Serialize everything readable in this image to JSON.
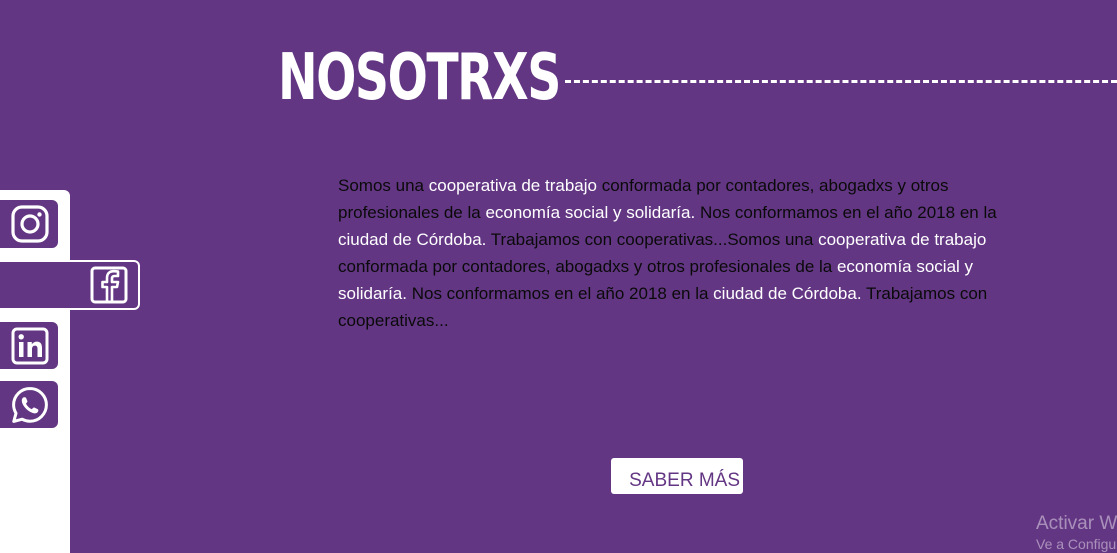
{
  "section": {
    "title": "NOSOTRXS"
  },
  "about": {
    "segments": [
      {
        "text": "Somos una ",
        "highlight": false
      },
      {
        "text": "cooperativa de trabajo",
        "highlight": true
      },
      {
        "text": " conformada por contadores, abogadxs y otros profesionales de la ",
        "highlight": false
      },
      {
        "text": "economía social y solidaría.",
        "highlight": true
      },
      {
        "text": " Nos conformamos en el año 2018 en la ",
        "highlight": false
      },
      {
        "text": "ciudad de Córdoba.",
        "highlight": true
      },
      {
        "text": " Trabajamos con cooperativas...Somos una ",
        "highlight": false
      },
      {
        "text": "cooperativa de trabajo",
        "highlight": true
      },
      {
        "text": " conformada por contadores, abogadxs y otros profesionales de la ",
        "highlight": false
      },
      {
        "text": "economía social y solidaría.",
        "highlight": true
      },
      {
        "text": " Nos conformamos en el año 2018 en la ",
        "highlight": false
      },
      {
        "text": "ciudad de Córdoba.",
        "highlight": true
      },
      {
        "text": " Trabajamos con cooperativas...",
        "highlight": false
      }
    ]
  },
  "cta": {
    "label": "SABER MÁS"
  },
  "social": [
    {
      "name": "instagram",
      "icon": "instagram-icon"
    },
    {
      "name": "facebook",
      "icon": "facebook-icon"
    },
    {
      "name": "linkedin",
      "icon": "linkedin-icon"
    },
    {
      "name": "whatsapp",
      "icon": "whatsapp-icon"
    }
  ],
  "watermark": {
    "title": "Activar W",
    "subtitle": "Ve a Configu"
  },
  "colors": {
    "background": "#633683",
    "accent_text": "#ffffff",
    "body_text": "#0a0a0a",
    "button_bg": "#ffffff",
    "button_text": "#633683"
  }
}
